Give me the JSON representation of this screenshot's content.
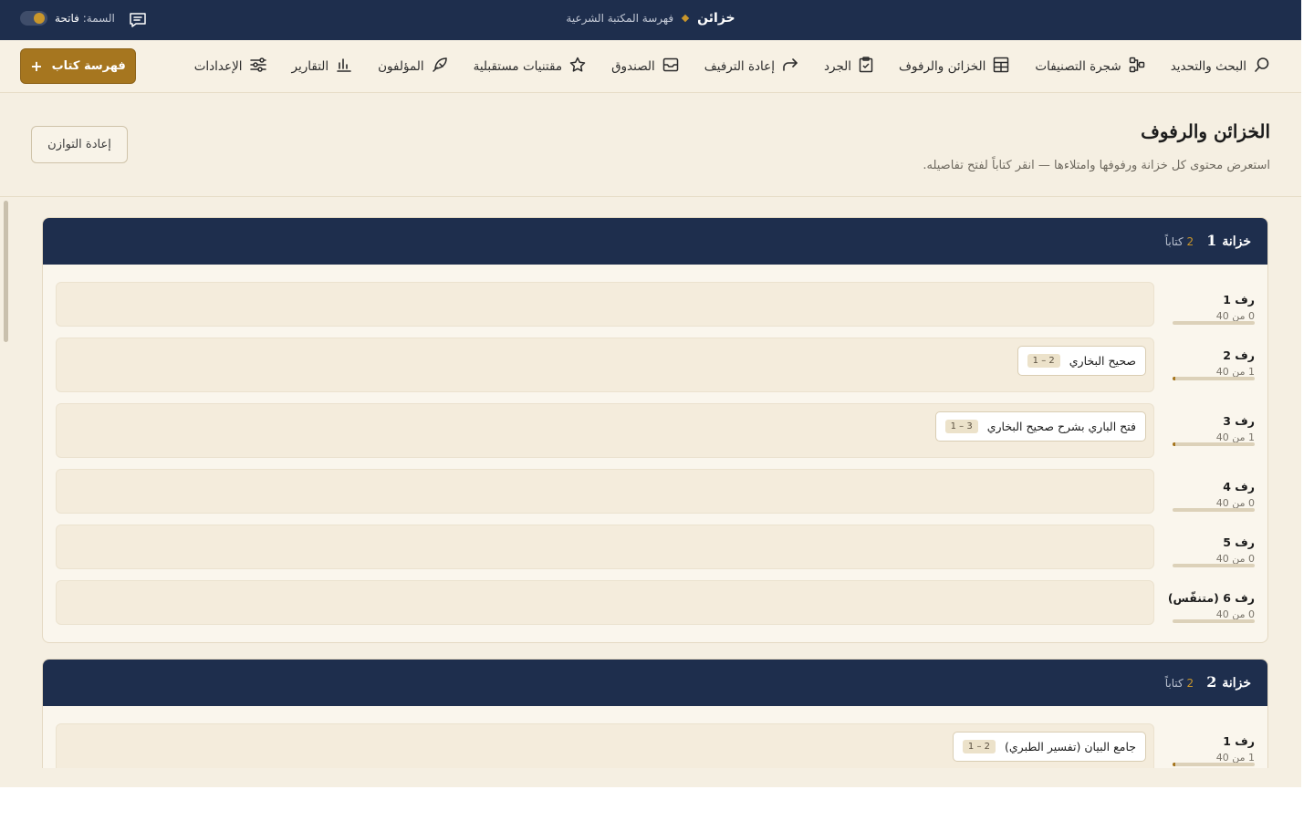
{
  "titlebar": {
    "app_name": "خزائن",
    "subtitle": "فهرسة المكتبة الشرعية",
    "theme_label": "السمة:",
    "theme_value": "فاتحة"
  },
  "nav": {
    "items": [
      {
        "label": "البحث والتحديد",
        "icon": "search-icon"
      },
      {
        "label": "شجرة التصنيفات",
        "icon": "tree-icon"
      },
      {
        "label": "الخزائن والرفوف",
        "icon": "grid-icon"
      },
      {
        "label": "الجرد",
        "icon": "clipboard-icon"
      },
      {
        "label": "إعادة الترفيف",
        "icon": "redo-arrow-icon"
      },
      {
        "label": "الصندوق",
        "icon": "mailbox-icon"
      },
      {
        "label": "مقتنيات مستقبلية",
        "icon": "star-icon"
      },
      {
        "label": "المؤلفون",
        "icon": "quill-icon"
      },
      {
        "label": "التقارير",
        "icon": "bar-chart-icon"
      },
      {
        "label": "الإعدادات",
        "icon": "sliders-icon"
      }
    ],
    "add_button": {
      "label": "فهرسة كتاب",
      "plus": "+"
    }
  },
  "page": {
    "title": "الخزائن والرفوف",
    "subtitle": "استعرض محتوى كل خزانة ورفوفها وامتلاءها — انقر كتاباً لفتح تفاصيله.",
    "rebalance_label": "إعادة التوازن"
  },
  "colors": {
    "navy": "#1e2e4d",
    "gold": "#a6761f",
    "background": "#f5efe2"
  },
  "cabinets": [
    {
      "label": "خزانة",
      "number": "1",
      "count_number": "2",
      "count_label": "كتاباً",
      "shelves": [
        {
          "name": "رف 1",
          "capacity_text": "0 من 40",
          "fill": 0,
          "books": []
        },
        {
          "name": "رف 2",
          "capacity_text": "1 من 40",
          "fill": 0.025,
          "books": [
            {
              "title": "صحيح البخاري",
              "code": "1 – 2"
            }
          ]
        },
        {
          "name": "رف 3",
          "capacity_text": "1 من 40",
          "fill": 0.025,
          "books": [
            {
              "title": "فتح الباري بشرح صحيح البخاري",
              "code": "1 – 3"
            }
          ]
        },
        {
          "name": "رف 4",
          "capacity_text": "0 من 40",
          "fill": 0,
          "books": []
        },
        {
          "name": "رف 5",
          "capacity_text": "0 من 40",
          "fill": 0,
          "books": []
        },
        {
          "name": "رف 6 (متنفّس)",
          "capacity_text": "0 من 40",
          "fill": 0,
          "books": []
        }
      ]
    },
    {
      "label": "خزانة",
      "number": "2",
      "count_number": "2",
      "count_label": "كتاباً",
      "shelves": [
        {
          "name": "رف 1",
          "capacity_text": "1 من 40",
          "fill": 0.025,
          "books": [
            {
              "title": "جامع البيان (تفسير الطبري)",
              "code": "1 – 2"
            }
          ]
        }
      ]
    }
  ]
}
